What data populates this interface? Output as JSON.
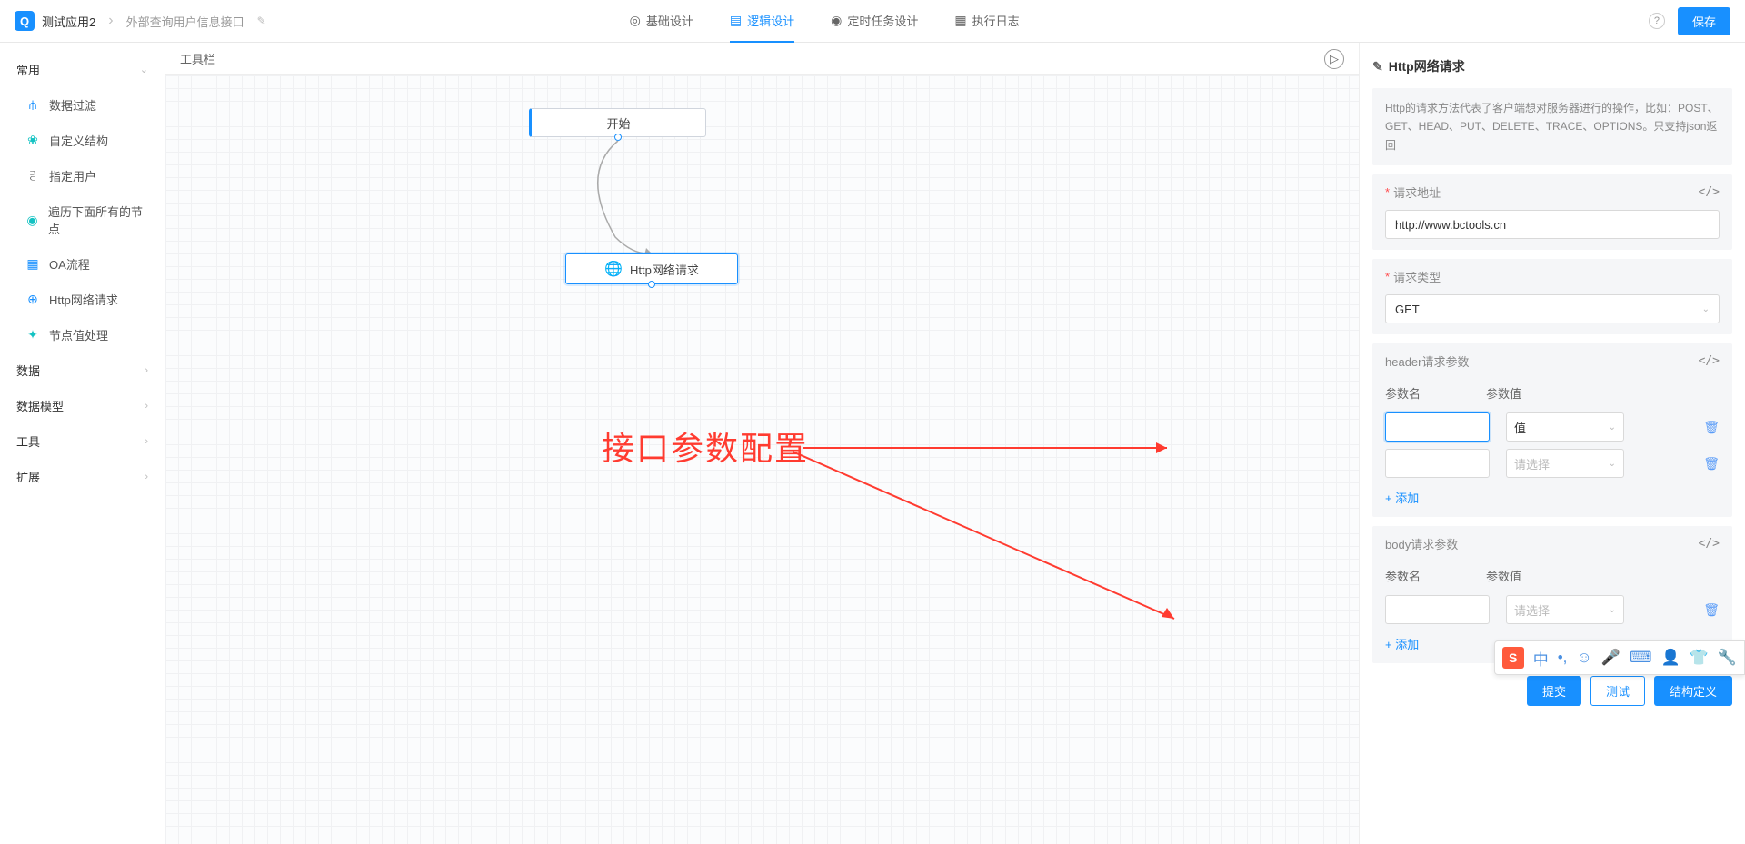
{
  "header": {
    "app_name": "测试应用2",
    "breadcrumb_item": "外部查询用户信息接口",
    "tabs": [
      {
        "label": "基础设计",
        "icon": "◎"
      },
      {
        "label": "逻辑设计",
        "icon": "▤"
      },
      {
        "label": "定时任务设计",
        "icon": "◉"
      },
      {
        "label": "执行日志",
        "icon": "▦"
      }
    ],
    "save_label": "保存"
  },
  "sidebar": {
    "group_common": "常用",
    "items": [
      {
        "label": "数据过滤",
        "icon": "⫛",
        "cls": "ic-blue"
      },
      {
        "label": "自定义结构",
        "icon": "❀",
        "cls": "ic-teal"
      },
      {
        "label": "指定用户",
        "icon": "⫔",
        "cls": "ic-dark"
      },
      {
        "label": "遍历下面所有的节点",
        "icon": "◉",
        "cls": "ic-teal"
      },
      {
        "label": "OA流程",
        "icon": "▦",
        "cls": "ic-blue"
      },
      {
        "label": "Http网络请求",
        "icon": "⊕",
        "cls": "ic-blue"
      },
      {
        "label": "节点值处理",
        "icon": "✦",
        "cls": "ic-teal"
      }
    ],
    "groups": [
      "数据",
      "数据模型",
      "工具",
      "扩展"
    ]
  },
  "canvas": {
    "toolbar_label": "工具栏",
    "start_label": "开始",
    "http_label": "Http网络请求",
    "annotation": "接口参数配置"
  },
  "rpanel": {
    "title": "Http网络请求",
    "desc": "Http的请求方法代表了客户端想对服务器进行的操作，比如：POST、GET、HEAD、PUT、DELETE、TRACE、OPTIONS。只支持json返回",
    "url_label": "请求地址",
    "url_value": "http://www.bctools.cn",
    "type_label": "请求类型",
    "type_value": "GET",
    "header_label": "header请求参数",
    "col_name": "参数名",
    "col_value": "参数值",
    "val_placeholder_filled": "值",
    "val_placeholder": "请选择",
    "add_label": "+ 添加",
    "body_label": "body请求参数",
    "btn_submit": "提交",
    "btn_test": "测试",
    "btn_struct": "结构定义"
  },
  "ime": {
    "lang": "中"
  }
}
